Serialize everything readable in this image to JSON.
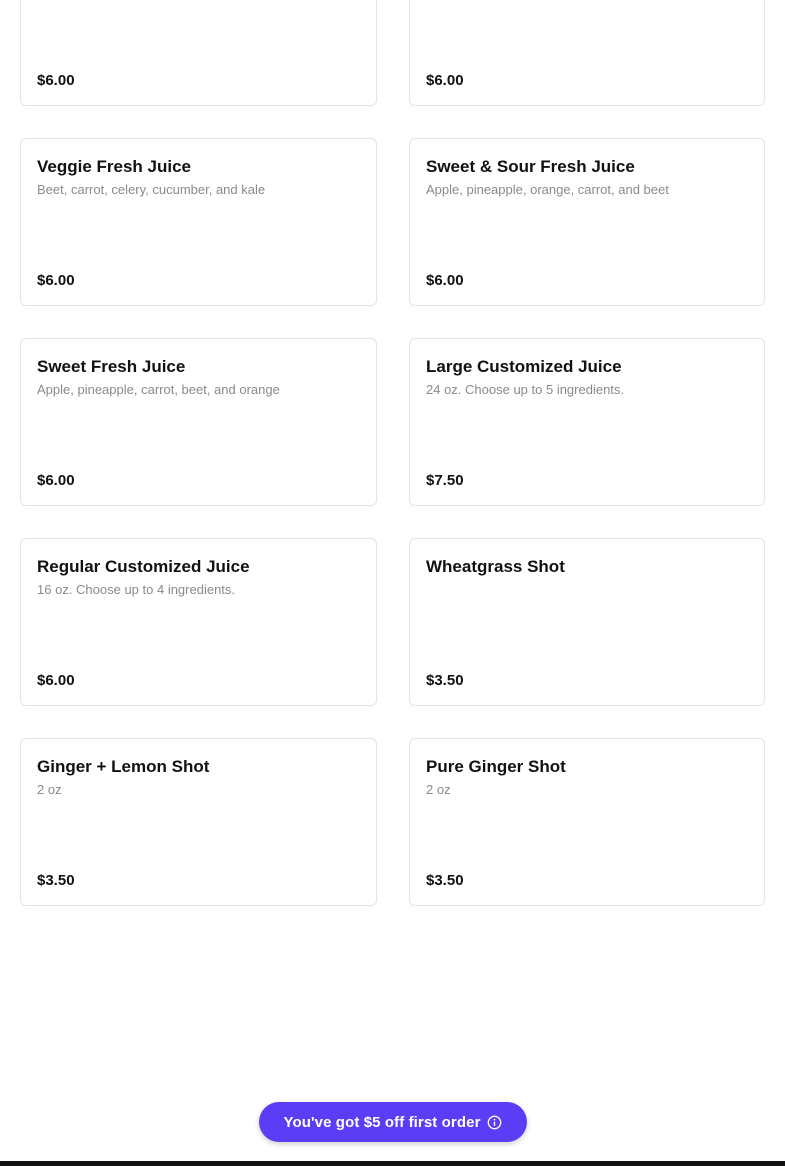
{
  "menu": {
    "items": [
      {
        "title": "",
        "description": "",
        "price": "$6.00"
      },
      {
        "title": "",
        "description": "",
        "price": "$6.00"
      },
      {
        "title": "Veggie Fresh Juice",
        "description": "Beet, carrot, celery, cucumber, and kale",
        "price": "$6.00"
      },
      {
        "title": "Sweet & Sour Fresh Juice",
        "description": "Apple, pineapple, orange, carrot, and beet",
        "price": "$6.00"
      },
      {
        "title": "Sweet Fresh Juice",
        "description": "Apple, pineapple, carrot, beet, and orange",
        "price": "$6.00"
      },
      {
        "title": "Large Customized Juice",
        "description": "24 oz. Choose up to 5 ingredients.",
        "price": "$7.50"
      },
      {
        "title": "Regular Customized Juice",
        "description": "16 oz. Choose up to 4 ingredients.",
        "price": "$6.00"
      },
      {
        "title": "Wheatgrass Shot",
        "description": "",
        "price": "$3.50"
      },
      {
        "title": "Ginger + Lemon Shot",
        "description": "2 oz",
        "price": "$3.50"
      },
      {
        "title": "Pure Ginger Shot",
        "description": "2 oz",
        "price": "$3.50"
      }
    ]
  },
  "promo": {
    "label": "You've got $5 off first order",
    "icon": "info-icon",
    "color": "#5b3df5"
  }
}
